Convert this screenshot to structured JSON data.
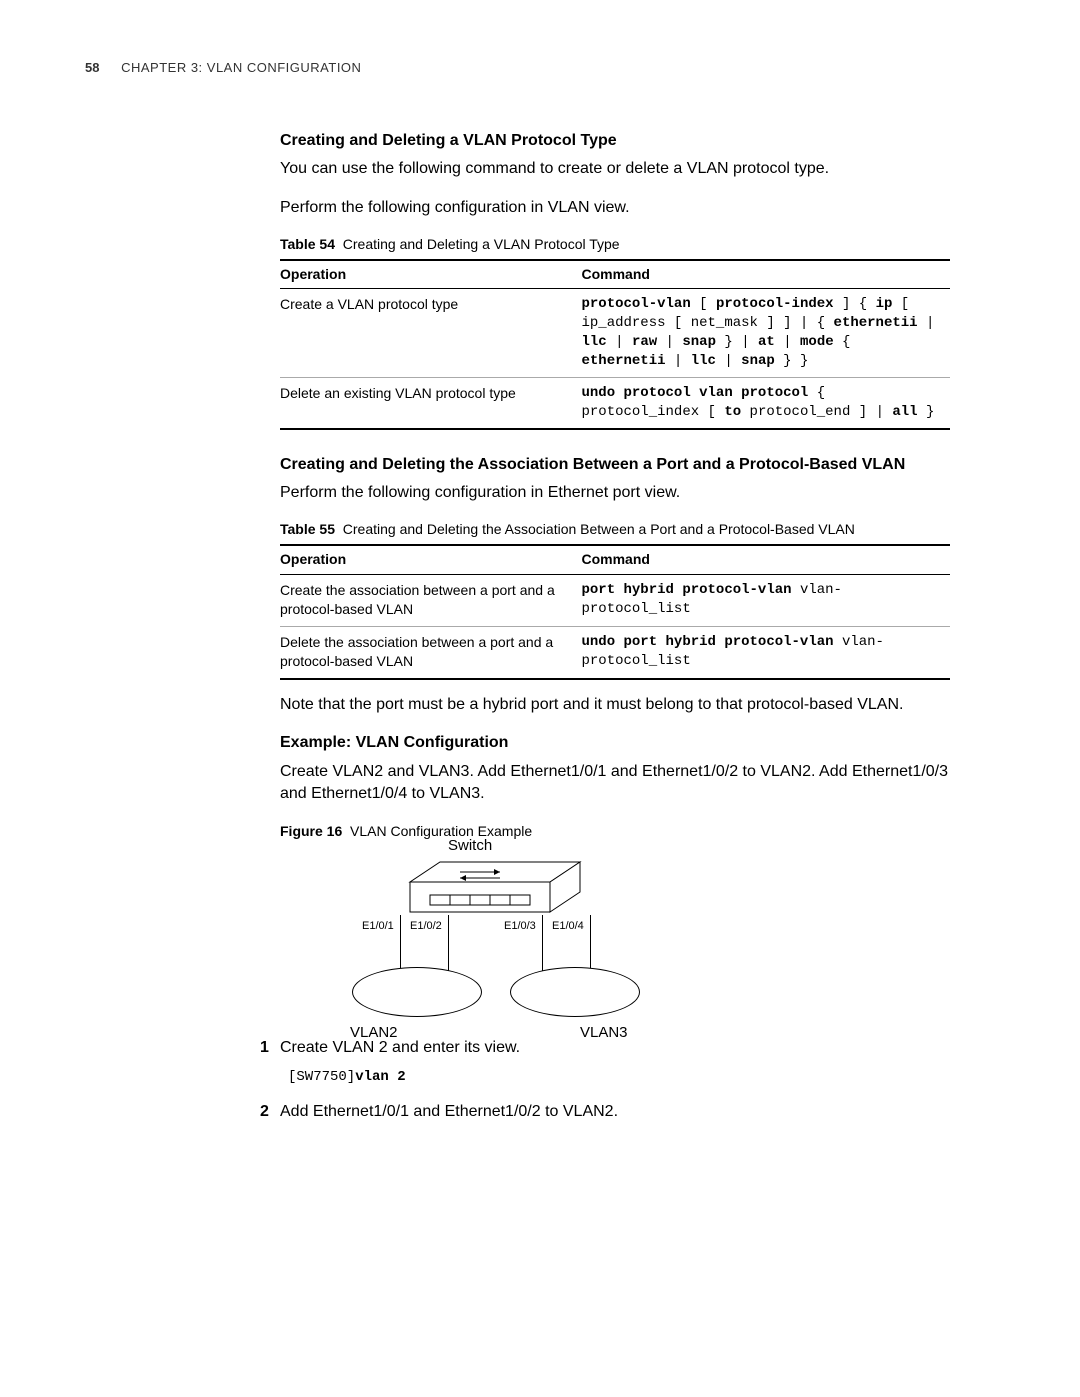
{
  "header": {
    "page_number": "58",
    "chapter": "CHAPTER 3: VLAN CONFIGURATION"
  },
  "section1": {
    "heading": "Creating and Deleting a VLAN Protocol Type",
    "intro": "You can use the following command to create or delete a VLAN protocol type.",
    "config_note": "Perform the following configuration in VLAN view.",
    "table_label": "Table 54",
    "table_title": "Creating and Deleting a VLAN Protocol Type",
    "col_operation": "Operation",
    "col_command": "Command",
    "row1_op": "Create a VLAN protocol type",
    "row1_cmd": "protocol-vlan [ protocol-index ] { ip [ ip_address [ net_mask ] ] | { ethernetii | llc | raw | snap } | at | mode { ethernetii | llc | snap } }",
    "row2_op": "Delete an existing VLAN protocol type",
    "row2_cmd": "undo protocol vlan protocol { protocol_index [ to protocol_end ] | all }"
  },
  "section2": {
    "heading": "Creating and Deleting the Association Between a Port and a Protocol-Based VLAN",
    "config_note": "Perform the following configuration in Ethernet port view.",
    "table_label": "Table 55",
    "table_title": "Creating and Deleting the Association Between a Port and a Protocol-Based VLAN",
    "col_operation": "Operation",
    "col_command": "Command",
    "row1_op": "Create the association between a port and a protocol-based VLAN",
    "row1_cmd": "port hybrid protocol-vlan vlan-protocol_list",
    "row2_op": "Delete the association between a port and a protocol-based VLAN",
    "row2_cmd": "undo port hybrid protocol-vlan vlan-protocol_list",
    "note": "Note that the port must be a hybrid port and it must belong to that protocol-based VLAN."
  },
  "example": {
    "heading": "Example: VLAN Configuration",
    "intro": "Create VLAN2 and VLAN3. Add Ethernet1/0/1 and Ethernet1/0/2 to VLAN2. Add Ethernet1/0/3 and Ethernet1/0/4 to VLAN3.",
    "figure_label": "Figure 16",
    "figure_title": "VLAN Configuration Example",
    "switch_label": "Switch",
    "port1": "E1/0/1",
    "port2": "E1/0/2",
    "port3": "E1/0/3",
    "port4": "E1/0/4",
    "vlan2_label": "VLAN2",
    "vlan3_label": "VLAN3",
    "step1_num": "1",
    "step1_text": "Create VLAN 2 and enter its view.",
    "step1_cli_prompt": "[SW7750]",
    "step1_cli_cmd": "vlan 2",
    "step2_num": "2",
    "step2_text": "Add Ethernet1/0/1 and Ethernet1/0/2 to VLAN2."
  }
}
